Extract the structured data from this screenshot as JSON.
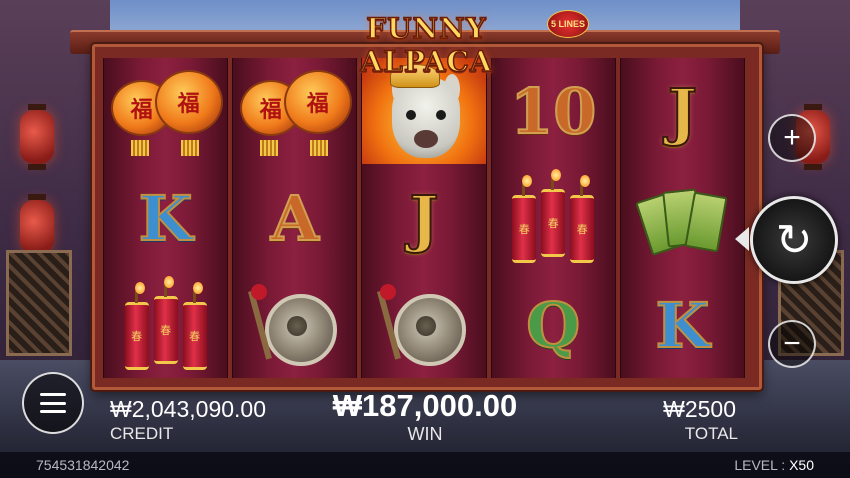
{
  "game": {
    "title": "FUNNY ALPACA",
    "lines_badge": "5 LINES"
  },
  "reels": {
    "r1": [
      "lantern",
      "K",
      "firecracker"
    ],
    "r2": [
      "lantern",
      "A",
      "gong"
    ],
    "r3": [
      "alpaca",
      "J",
      "gong"
    ],
    "r4": [
      "10",
      "firecracker",
      "Q"
    ],
    "r5": [
      "J",
      "tiles",
      "K"
    ],
    "lantern_char": "福",
    "firecracker_char": "春"
  },
  "controls": {
    "plus": "+",
    "minus": "−",
    "spin": "↻"
  },
  "hud": {
    "credit_value": "₩2,043,090.00",
    "credit_label": "CREDIT",
    "win_value": "₩187,000.00",
    "win_label": "WIN",
    "total_value": "₩2500",
    "total_label": "TOTAL"
  },
  "footer": {
    "game_id": "754531842042",
    "level_label": "LEVEL :",
    "level_value": "X50"
  },
  "colors": {
    "gold": "#e6b84a",
    "reel_bg": "#7a1a36",
    "frame": "#7a2a22"
  },
  "icons": [
    "plus-icon",
    "minus-icon",
    "spin-icon",
    "menu-icon"
  ]
}
